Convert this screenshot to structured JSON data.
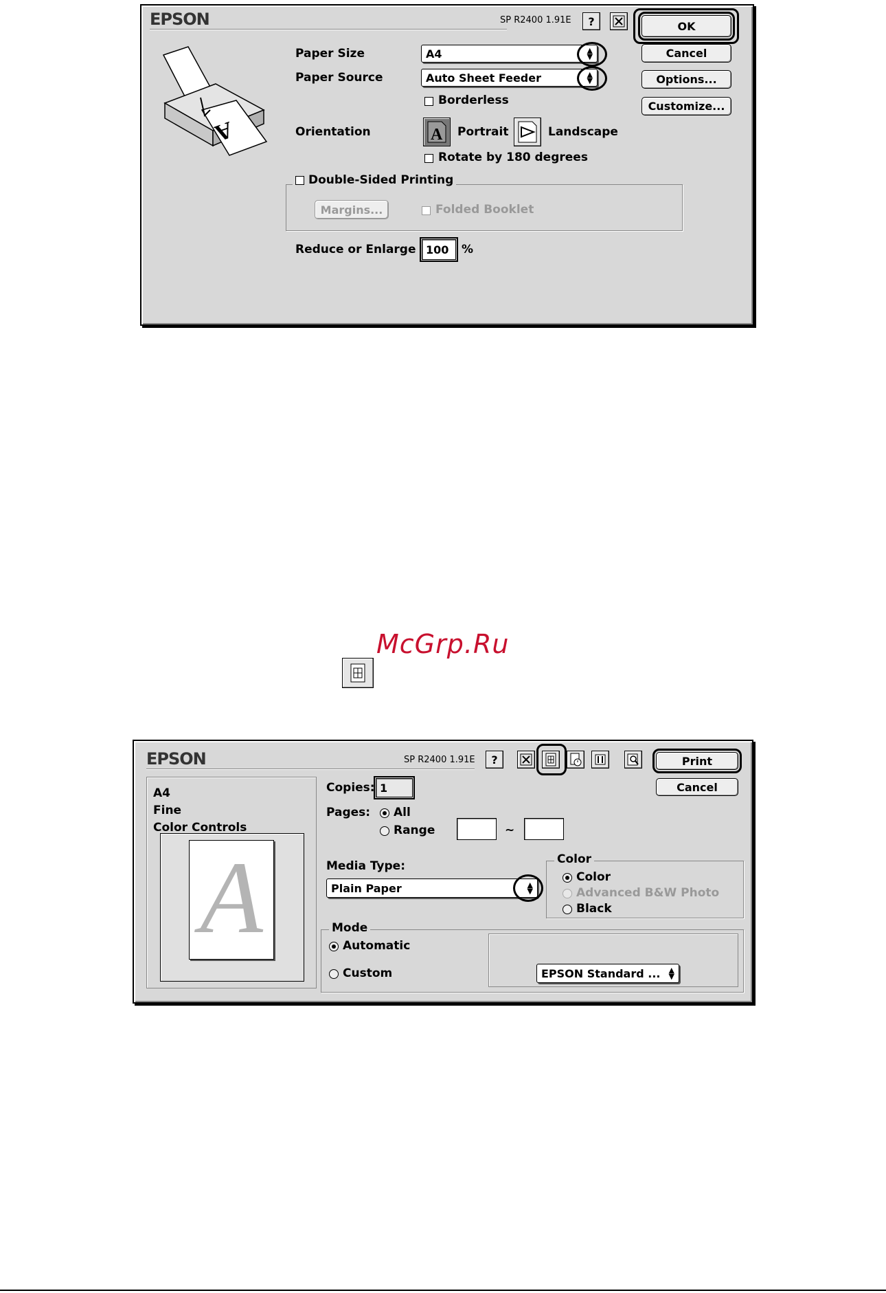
{
  "watermark": "McGrp.Ru",
  "page_setup": {
    "brand": "EPSON",
    "version": "SP R2400 1.91E",
    "help_icon": "question-icon",
    "paper_size_label": "Paper Size",
    "paper_size_value": "A4",
    "paper_source_label": "Paper Source",
    "paper_source_value": "Auto Sheet Feeder",
    "borderless_label": "Borderless",
    "orientation_label": "Orientation",
    "portrait_label": "Portrait",
    "landscape_label": "Landscape",
    "rotate_label": "Rotate by 180 degrees",
    "double_sided_label": "Double-Sided Printing",
    "margins_label": "Margins...",
    "folded_booklet_label": "Folded Booklet",
    "reduce_enlarge_label": "Reduce or Enlarge",
    "reduce_enlarge_value": "100",
    "percent_sign": "%",
    "ok_label": "OK",
    "cancel_label": "Cancel",
    "options_label": "Options...",
    "customize_label": "Customize..."
  },
  "print": {
    "brand": "EPSON",
    "version": "SP R2400 1.91E",
    "summary": [
      "A4",
      "Fine",
      "Color Controls"
    ],
    "preview_letter": "A",
    "copies_label": "Copies:",
    "copies_value": "1",
    "pages_label": "Pages:",
    "all_label": "All",
    "range_label": "Range",
    "range_sep": "~",
    "media_type_label": "Media Type:",
    "media_type_value": "Plain Paper",
    "color_group_label": "Color",
    "color_label": "Color",
    "advanced_bw_label": "Advanced B&W Photo",
    "black_label": "Black",
    "mode_group_label": "Mode",
    "automatic_label": "Automatic",
    "custom_label": "Custom",
    "mode_select_value": "EPSON Standard ...",
    "print_label": "Print",
    "cancel_label": "Cancel"
  }
}
